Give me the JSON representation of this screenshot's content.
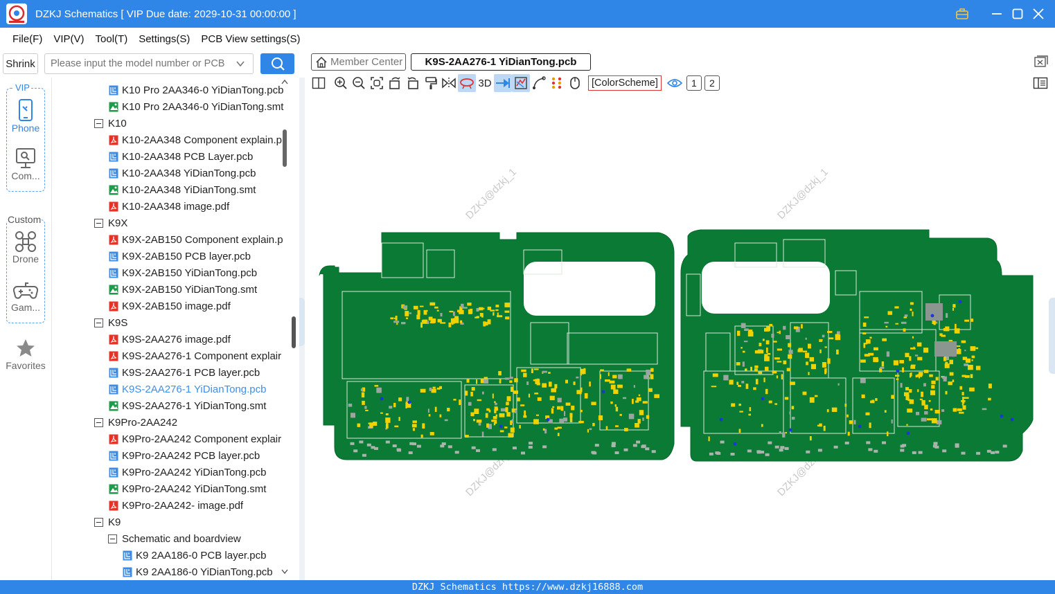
{
  "window": {
    "title": "DZKJ Schematics [ VIP Due date: 2029-10-31 00:00:00 ]"
  },
  "menu": [
    "File(F)",
    "VIP(V)",
    "Tool(T)",
    "Settings(S)",
    "PCB View settings(S)"
  ],
  "sidebar": {
    "shrink_label": "Shrink",
    "search_placeholder": "Please input the model number or PCB",
    "vip_label": "VIP",
    "phone_label": "Phone",
    "computer_label": "Com...",
    "custom_label": "Custom",
    "drone_label": "Drone",
    "game_label": "Gam...",
    "favorites_label": "Favorites"
  },
  "tree": [
    {
      "type": "pcb",
      "label": "K10 Pro 2AA346-0 YiDianTong.pcb",
      "level": 1
    },
    {
      "type": "smt",
      "label": "K10 Pro 2AA346-0 YiDianTong.smt",
      "level": 1
    },
    {
      "type": "folder",
      "label": "K10",
      "level": 0
    },
    {
      "type": "pdf",
      "label": "K10-2AA348 Component explain.p",
      "level": 1
    },
    {
      "type": "pcb",
      "label": "K10-2AA348 PCB Layer.pcb",
      "level": 1
    },
    {
      "type": "pcb",
      "label": "K10-2AA348 YiDianTong.pcb",
      "level": 1
    },
    {
      "type": "smt",
      "label": "K10-2AA348 YiDianTong.smt",
      "level": 1
    },
    {
      "type": "pdf",
      "label": "K10-2AA348 image.pdf",
      "level": 1
    },
    {
      "type": "folder",
      "label": "K9X",
      "level": 0
    },
    {
      "type": "pdf",
      "label": "K9X-2AB150 Component explain.p",
      "level": 1
    },
    {
      "type": "pcb",
      "label": "K9X-2AB150 PCB layer.pcb",
      "level": 1
    },
    {
      "type": "pcb",
      "label": "K9X-2AB150 YiDianTong.pcb",
      "level": 1
    },
    {
      "type": "smt",
      "label": "K9X-2AB150 YiDianTong.smt",
      "level": 1
    },
    {
      "type": "pdf",
      "label": "K9X-2AB150 image.pdf",
      "level": 1
    },
    {
      "type": "folder",
      "label": "K9S",
      "level": 0
    },
    {
      "type": "pdf",
      "label": "K9S-2AA276 image.pdf",
      "level": 1
    },
    {
      "type": "pdf",
      "label": "K9S-2AA276-1 Component explair",
      "level": 1
    },
    {
      "type": "pcb",
      "label": "K9S-2AA276-1 PCB layer.pcb",
      "level": 1
    },
    {
      "type": "pcb",
      "label": "K9S-2AA276-1 YiDianTong.pcb",
      "level": 1,
      "selected": true
    },
    {
      "type": "smt",
      "label": "K9S-2AA276-1 YiDianTong.smt",
      "level": 1
    },
    {
      "type": "folder",
      "label": "K9Pro-2AA242",
      "level": 0
    },
    {
      "type": "pdf",
      "label": "K9Pro-2AA242 Component explair",
      "level": 1
    },
    {
      "type": "pcb",
      "label": "K9Pro-2AA242 PCB layer.pcb",
      "level": 1
    },
    {
      "type": "pcb",
      "label": "K9Pro-2AA242 YiDianTong.pcb",
      "level": 1
    },
    {
      "type": "smt",
      "label": "K9Pro-2AA242 YiDianTong.smt",
      "level": 1
    },
    {
      "type": "pdf",
      "label": "K9Pro-2AA242- image.pdf",
      "level": 1
    },
    {
      "type": "folder",
      "label": "K9",
      "level": 0
    },
    {
      "type": "folder",
      "label": "Schematic and boardview",
      "level": 1
    },
    {
      "type": "pcb",
      "label": "K9 2AA186-0 PCB layer.pcb",
      "level": 2
    },
    {
      "type": "pcb",
      "label": "K9 2AA186-0 YiDianTong.pcb",
      "level": 2
    }
  ],
  "tabs": {
    "member": "Member Center",
    "active": "K9S-2AA276-1 YiDianTong.pcb"
  },
  "toolbar": {
    "three_d": "3D",
    "color_scheme": "[ColorScheme]",
    "layer1": "1",
    "layer2": "2"
  },
  "watermark": "DZKJ@dzkj_1",
  "colors": {
    "accent": "#2f86e6",
    "pcb": "#0b7a35",
    "pad": "#f0d200"
  },
  "status": "DZKJ Schematics https://www.dzkj16888.com"
}
